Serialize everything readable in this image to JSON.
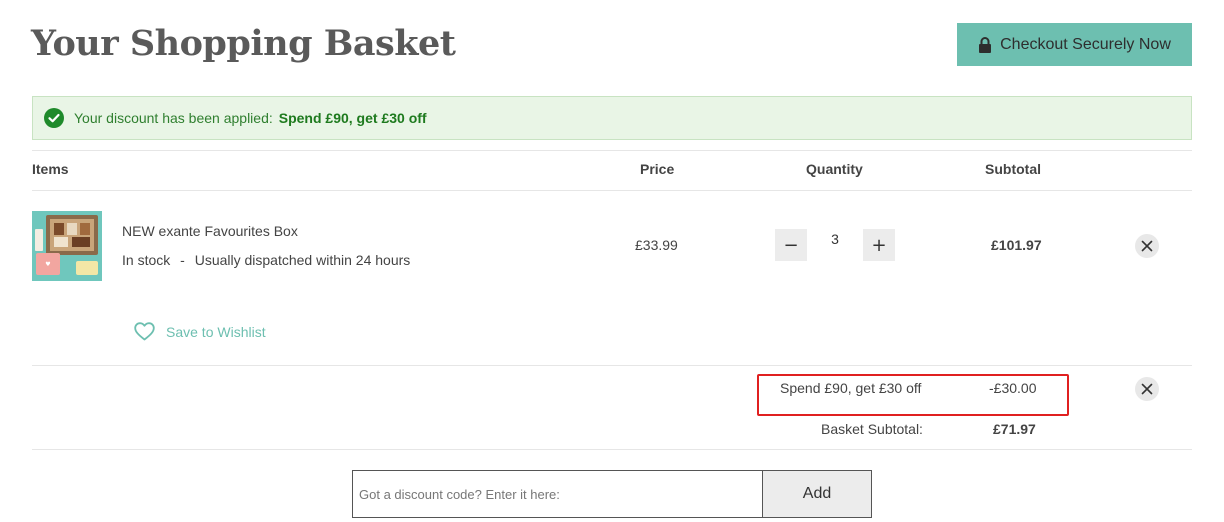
{
  "header": {
    "title": "Your Shopping Basket",
    "checkout_label": "Checkout Securely Now"
  },
  "alert": {
    "message": "Your discount has been applied:",
    "discount_name": "Spend £90, get £30 off"
  },
  "table": {
    "headers": {
      "items": "Items",
      "price": "Price",
      "quantity": "Quantity",
      "subtotal": "Subtotal"
    }
  },
  "item": {
    "name": "NEW exante Favourites Box",
    "stock_status": "In stock",
    "separator": "-",
    "dispatch": "Usually dispatched within 24 hours",
    "price": "£33.99",
    "quantity": "3",
    "subtotal": "£101.97",
    "wishlist_label": "Save to Wishlist"
  },
  "summary": {
    "discount_label": "Spend £90, get £30 off",
    "discount_amount": "-£30.00",
    "basket_subtotal_label": "Basket Subtotal:",
    "basket_subtotal_value": "£71.97"
  },
  "discount_code": {
    "placeholder": "Got a discount code? Enter it here:",
    "add_label": "Add"
  },
  "colors": {
    "accent": "#6dbfb0",
    "success_bg": "#e9f5e6",
    "success_text": "#2f7f2f",
    "highlight": "#e02020"
  }
}
